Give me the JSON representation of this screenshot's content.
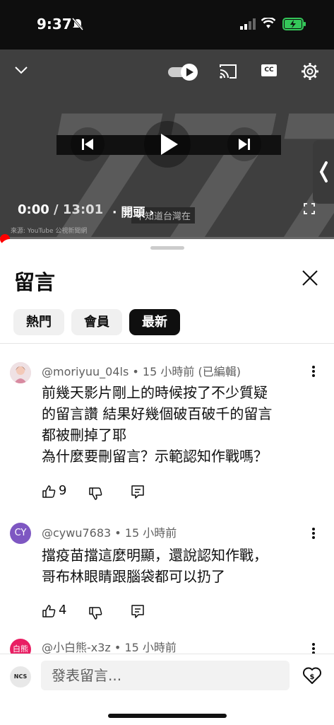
{
  "status": {
    "time": "9:37"
  },
  "player": {
    "cc_label": "CC",
    "time_current": "0:00",
    "time_sep": " / ",
    "time_total": "13:01",
    "chapter_dot": "·",
    "chapter_label": "開頭",
    "caption": "不知道台灣在",
    "source": "來源: YouTube 公視新聞網"
  },
  "sheet": {
    "title": "留言",
    "chips": [
      "熱門",
      "會員",
      "最新"
    ],
    "active_chip": "最新"
  },
  "comments": [
    {
      "avatar_text": "",
      "author": "@moriyuu_04ls",
      "time": "15 小時前",
      "edited": "(已編輯)",
      "lines": [
        "前幾天影片剛上的時候按了不少質疑",
        "的留言讚 結果好幾個破百破千的留言",
        "都被刪掉了耶",
        "為什麼要刪留言？示範認知作戰嗎？"
      ],
      "likes": "9"
    },
    {
      "avatar_text": "CY",
      "author": "@cywu7683",
      "time": "15 小時前",
      "edited": "",
      "lines": [
        "擋疫苗擋這麼明顯，還說認知作戰，",
        "哥布林眼睛跟腦袋都可以扔了"
      ],
      "likes": "4"
    },
    {
      "avatar_text": "白熊",
      "author": "@小白熊-x3z",
      "time": "15 小時前",
      "edited": "",
      "lines": [],
      "likes": ""
    }
  ],
  "composer": {
    "avatar_text": "NCS",
    "placeholder": "發表留言..."
  },
  "colors": {
    "accent_red": "#ff0000",
    "cy_avatar": "#7e57c2",
    "bear_avatar": "#e91e63"
  }
}
